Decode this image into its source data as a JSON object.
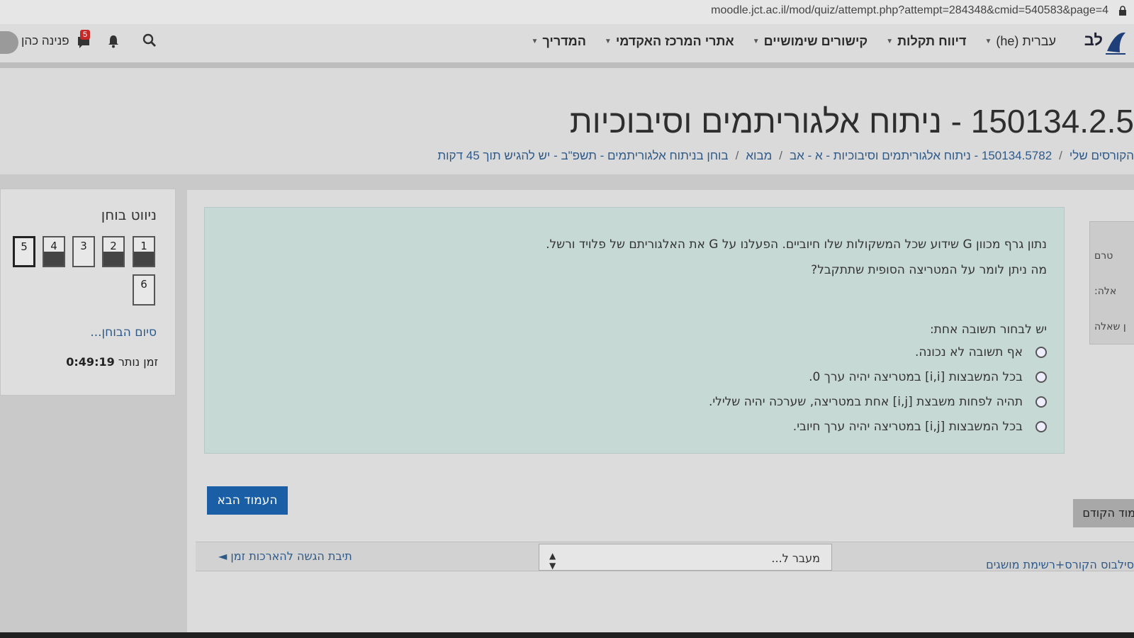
{
  "browser": {
    "url": "moodle.jct.ac.il/mod/quiz/attempt.php?attempt=284348&cmid=540583&page=4"
  },
  "navbar": {
    "brand": "לב",
    "menu": [
      {
        "label": "המדריך"
      },
      {
        "label": "אתרי המרכז האקדמי"
      },
      {
        "label": "קישורים שימושיים"
      },
      {
        "label": "דיווח תקלות"
      },
      {
        "label": "עברית (he)"
      }
    ],
    "user_name": "פנינה כהן",
    "message_count": "5"
  },
  "header": {
    "title": "150134.2.5 - ניתוח אלגוריתמים וסיבוכיות",
    "breadcrumb": [
      "הקורסים שלי",
      "150134.5782 - ניתוח אלגוריתמים וסיבוכיות - א - אב",
      "מבוא",
      "בוחן בניתוח אלגוריתמים - תשפ\"ב - יש להגיש תוך 45 דקות"
    ]
  },
  "quiz_nav": {
    "title": "ניווט בוחן",
    "questions": [
      {
        "num": "1",
        "answered": true
      },
      {
        "num": "2",
        "answered": true
      },
      {
        "num": "3",
        "answered": false
      },
      {
        "num": "4",
        "answered": true
      },
      {
        "num": "5",
        "answered": false,
        "current": true
      },
      {
        "num": "6",
        "answered": false
      }
    ],
    "finish_label": "סיום הבוחן...",
    "time_left_label": "זמן נותר",
    "time_left": "0:49:19"
  },
  "question": {
    "text_line1": "נתון גרף מכוון G שידוע שכל המשקולות שלו חיוביים. הפעלנו על G את האלגוריתם של פלויד ורשל.",
    "text_line2": "מה ניתן לומר על המטריצה הסופית שתתקבל?",
    "prompt": "יש לבחור תשובה אחת:",
    "options": [
      "אף תשובה לא נכונה.",
      "בכל המשבצות [i,i] במטריצה יהיה ערך 0.",
      "תהיה לפחות משבצת [i,j] אחת במטריצה, שערכה יהיה שלילי.",
      "בכל המשבצות [i,j] במטריצה יהיה ערך חיובי."
    ]
  },
  "info_tab": {
    "line1": "טרם",
    "line2": "אלה:",
    "line3": "ן שאלה"
  },
  "buttons": {
    "next": "העמוד הבא",
    "prev": "עמוד הקודם"
  },
  "activity_nav": {
    "prev_activity": "סילבוס הקורס+רשימת מושגים",
    "jump_placeholder": "מעבר ל...",
    "next_activity": "תיבת הגשה להארכות זמן ◄"
  }
}
